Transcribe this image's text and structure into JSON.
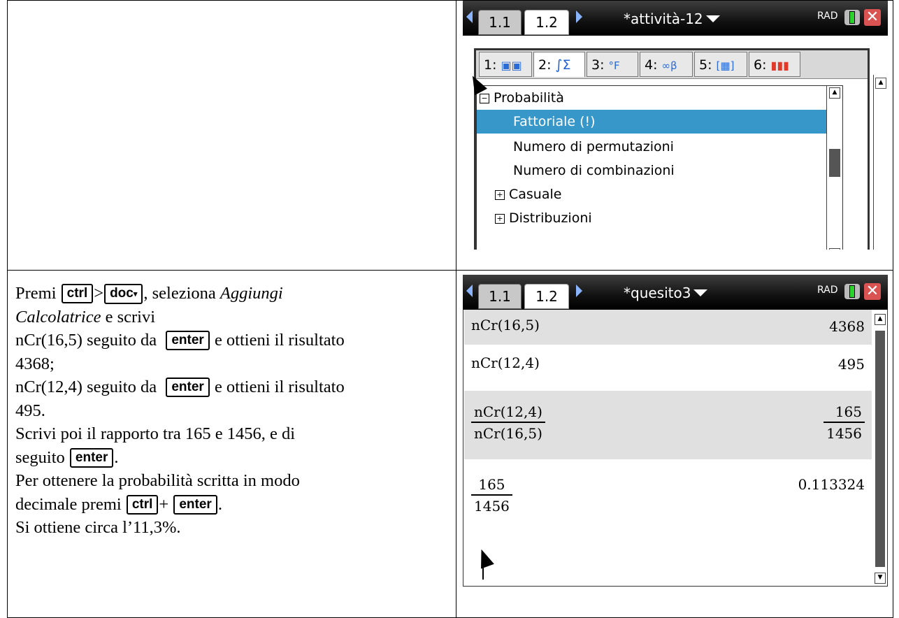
{
  "instructions": {
    "l1_a": "Premi",
    "key_ctrl": "ctrl",
    "sep_gt": ">",
    "key_doc": "doc",
    "key_doc_caret": "▾",
    "l1_b": ", seleziona",
    "l1_c": "Aggiungi",
    "l2_a": "Calcolatrice",
    "l2_b": " e scrivi",
    "l3_a": "nCr(16,5) seguito da",
    "key_enter": "enter",
    "l3_b": "e ottieni il risultato",
    "l4": "4368;",
    "l5_a": "nCr(12,4) seguito da",
    "l5_b": "e ottieni il risultato",
    "l6": "495.",
    "l7": "Scrivi poi il rapporto tra 165 e 1456, e di",
    "l8_a": "seguito",
    "l8_b": ".",
    "l9": "Per ottenere la probabilità scritta in modo",
    "l10_a": "decimale premi",
    "sep_plus": "+",
    "l10_b": ".",
    "l11": "Si ottiene circa l’11,3%."
  },
  "screen_top": {
    "tabs": [
      "1.1",
      "1.2"
    ],
    "doc_title": "*attività-12",
    "mode": "RAD",
    "menu_tabs": [
      {
        "num": "1:",
        "icon": "book-icon"
      },
      {
        "num": "2:",
        "label": "∫Σ"
      },
      {
        "num": "3:",
        "icon": "units-icon"
      },
      {
        "num": "4:",
        "icon": "infinity-beta-icon"
      },
      {
        "num": "5:",
        "icon": "matrix-icon"
      },
      {
        "num": "6:",
        "icon": "bar-chart-icon"
      }
    ],
    "menu_items": [
      {
        "label": "Probabilità",
        "expander": "−"
      },
      {
        "label": "Fattoriale (!)",
        "selected": true
      },
      {
        "label": "Numero di permutazioni"
      },
      {
        "label": "Numero di combinazioni"
      },
      {
        "label": "Casuale",
        "expander": "+"
      },
      {
        "label": "Distribuzioni",
        "expander": "+"
      }
    ]
  },
  "screen_bottom": {
    "tabs": [
      "1.1",
      "1.2"
    ],
    "doc_title": "*quesito3",
    "mode": "RAD",
    "rows": [
      {
        "expr": "nCr(16,5)",
        "result": "4368"
      },
      {
        "expr": "nCr(12,4)",
        "result": "495"
      },
      {
        "expr_num": "nCr(12,4)",
        "expr_den": "nCr(16,5)",
        "res_num": "165",
        "res_den": "1456"
      },
      {
        "expr_num": "165",
        "expr_den": "1456",
        "result": "0.113324"
      }
    ]
  },
  "colors": {
    "selection": "#3797c9",
    "titlebar": "#000000",
    "row_shade": "#e0e0e0",
    "close": "#d95353"
  }
}
